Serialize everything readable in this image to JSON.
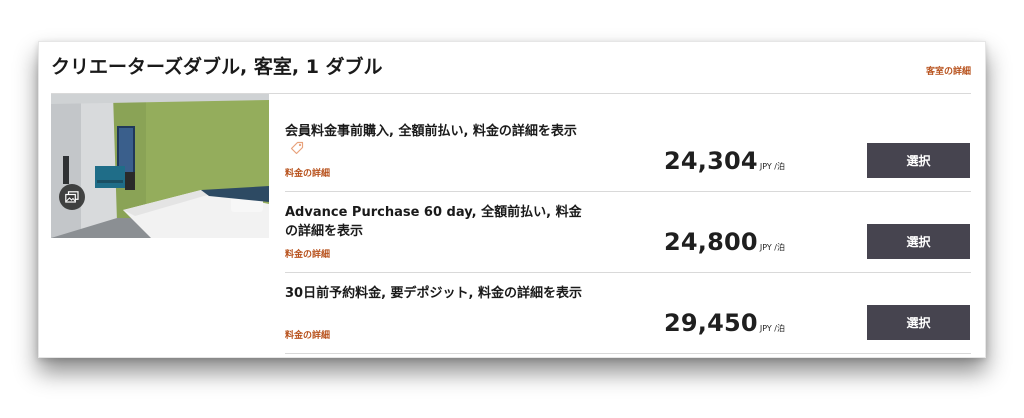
{
  "room": {
    "title": "クリエーターズダブル, 客室, 1 ダブル",
    "details_link": "客室の詳細"
  },
  "rates": [
    {
      "name": "会員料金事前購入, 全額前払い, 料金の詳細を表示",
      "has_tag_icon": true,
      "details_link": "料金の詳細",
      "price": "24,304",
      "unit": "JPY /泊",
      "select_label": "選択"
    },
    {
      "name": "Advance Purchase 60 day, 全額前払い, 料金の詳細を表示",
      "has_tag_icon": false,
      "details_link": "料金の詳細",
      "price": "24,800",
      "unit": "JPY /泊",
      "select_label": "選択"
    },
    {
      "name": "30日前予約料金, 要デポジット, 料金の詳細を表示",
      "has_tag_icon": false,
      "details_link": "料金の詳細",
      "price": "29,450",
      "unit": "JPY /泊",
      "select_label": "選択"
    }
  ],
  "colors": {
    "link": "#b8521d",
    "button": "#46444f",
    "tag_icon": "#e8a27c"
  },
  "icons": {
    "tag": "price-tag-icon",
    "gallery": "photo-gallery-icon"
  }
}
